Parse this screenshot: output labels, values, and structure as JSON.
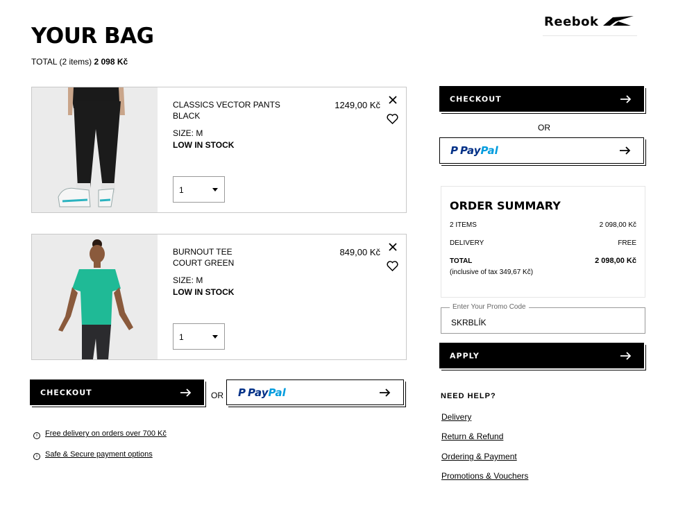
{
  "brand": {
    "logo_text": "Reebok"
  },
  "header": {
    "title": "YOUR BAG",
    "total_label": "TOTAL (2 items)",
    "total_value": "2 098 Kč"
  },
  "items": [
    {
      "name": "CLASSICS VECTOR PANTS",
      "color": "BLACK",
      "size": "SIZE: M",
      "stock": "LOW IN STOCK",
      "price": "1249,00 Kč",
      "quantity": "1",
      "image": "black-track-pants-model"
    },
    {
      "name": "BURNOUT TEE",
      "color": "COURT GREEN",
      "size": "SIZE: M",
      "stock": "LOW IN STOCK",
      "price": "849,00 Kč",
      "quantity": "1",
      "image": "green-tee-model"
    }
  ],
  "actions": {
    "checkout_label": "CHECKOUT",
    "or_label": "OR",
    "paypal_pay": "Pay",
    "paypal_pal": "Pal",
    "apply_label": "APPLY"
  },
  "info_links": [
    "Free delivery on orders over 700 Kč",
    "Safe & Secure payment options"
  ],
  "summary": {
    "title": "ORDER SUMMARY",
    "items_label": "2 ITEMS",
    "items_value": "2 098,00 Kč",
    "delivery_label": "DELIVERY",
    "delivery_value": "FREE",
    "total_label": "TOTAL",
    "total_value": "2 098,00 Kč",
    "tax_note": "(inclusive of tax  349,67 Kč)"
  },
  "promo": {
    "placeholder": "Enter Your Promo Code",
    "value": "SKRBLÍK"
  },
  "help": {
    "title": "NEED HELP?",
    "links": [
      "Delivery",
      "Return & Refund",
      "Ordering & Payment",
      "Promotions & Vouchers"
    ]
  },
  "colors": {
    "primary": "#000000",
    "paypal_dark": "#003087",
    "paypal_light": "#009cde",
    "tee_green": "#1fba96"
  }
}
